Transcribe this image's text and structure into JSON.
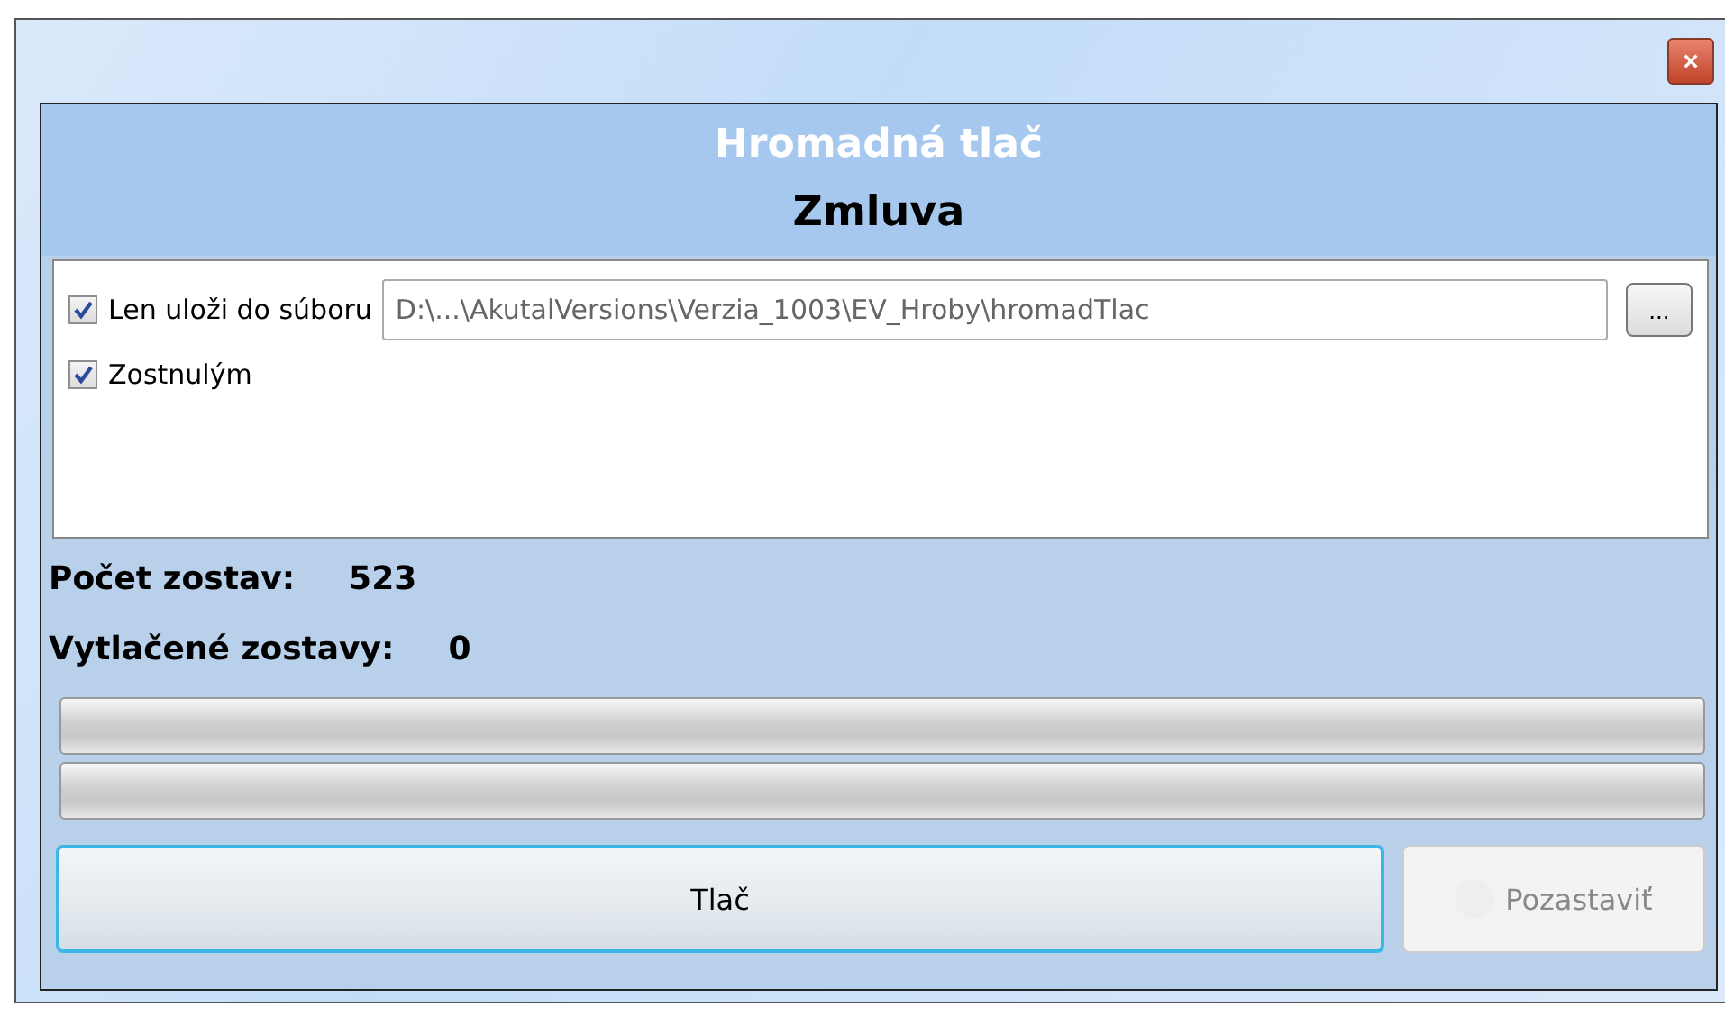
{
  "window": {
    "close": "×"
  },
  "header": {
    "title": "Hromadná tlač",
    "subtitle": "Zmluva"
  },
  "options": [
    {
      "label": "Len uloži do súboru",
      "checked": true,
      "path": "D:\\...\\AkutalVersions\\Verzia_1003\\EV_Hroby\\hromadTlac",
      "browse": "..."
    },
    {
      "label": "Zostnulým",
      "checked": true
    }
  ],
  "stats": [
    {
      "label": "Počet zostav:",
      "value": "523"
    },
    {
      "label": "Vytlačené zostavy:",
      "value": "0"
    }
  ],
  "progress": [
    {
      "level": 0
    },
    {
      "level": 0
    }
  ],
  "buttons": [
    {
      "label": "Tlač",
      "disabled": false
    },
    {
      "label": "Pozastaviť",
      "disabled": true
    }
  ]
}
